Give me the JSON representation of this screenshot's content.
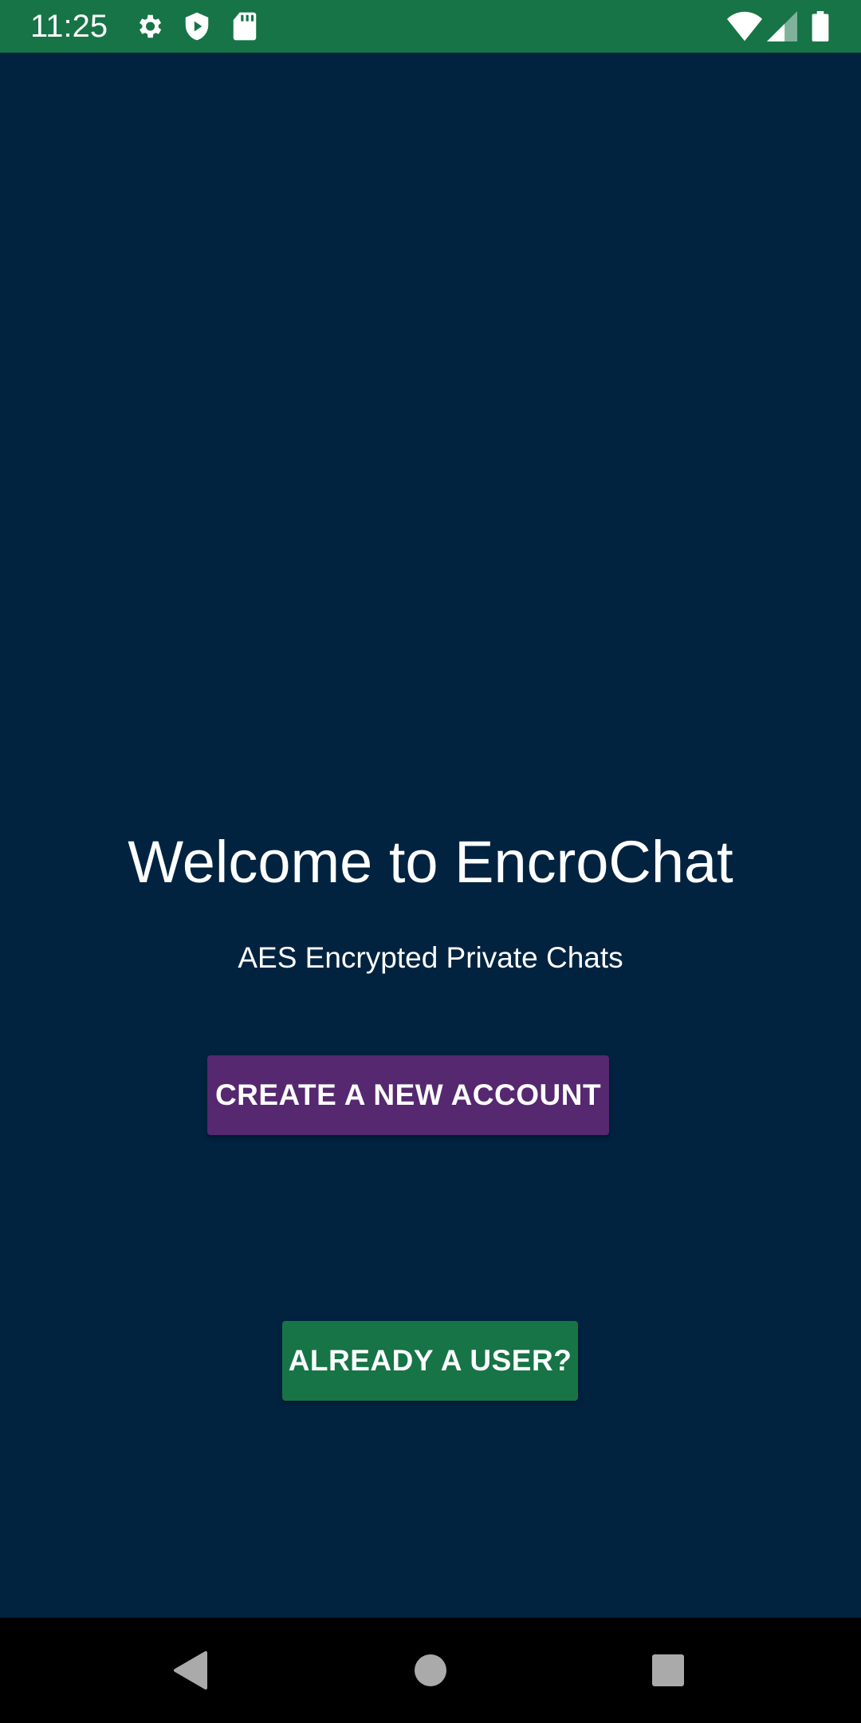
{
  "status_bar": {
    "time": "11:25",
    "icons": [
      "gear-icon",
      "shield-play-icon",
      "sd-card-icon",
      "wifi-icon",
      "signal-icon",
      "battery-icon"
    ],
    "background": "#167447"
  },
  "welcome": {
    "title": "Welcome to EncroChat",
    "subtitle": "AES Encrypted Private Chats"
  },
  "buttons": {
    "create_account": "CREATE A NEW ACCOUNT",
    "already_user": "ALREADY A USER?"
  },
  "nav_bar": {
    "icons": [
      "back-icon",
      "home-icon",
      "recents-icon"
    ]
  },
  "colors": {
    "background": "#012340",
    "create_button": "#55286F",
    "login_button": "#167447",
    "text": "#FFFFFF"
  }
}
